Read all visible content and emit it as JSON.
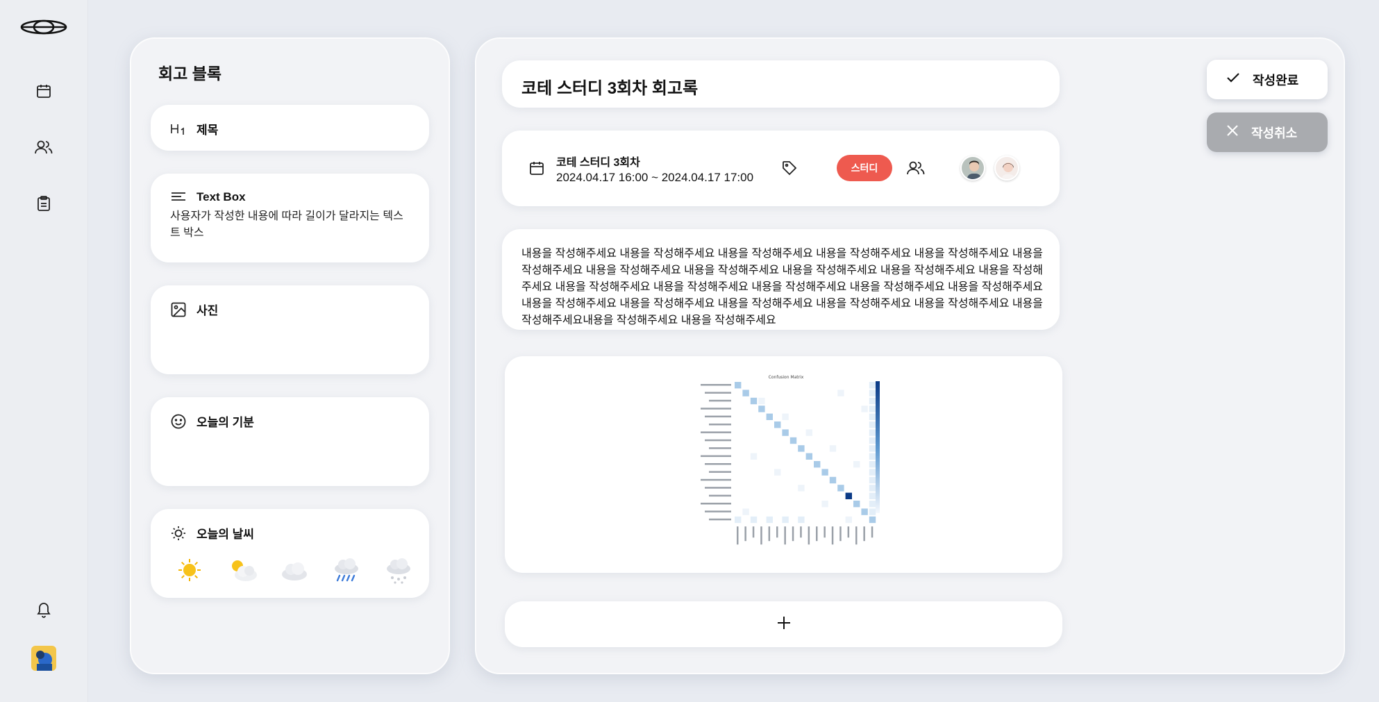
{
  "sidebar": {
    "logo_icon": "eye-logo-icon",
    "items": [
      {
        "name": "calendar",
        "icon": "calendar-icon"
      },
      {
        "name": "team",
        "icon": "users-icon"
      },
      {
        "name": "retrospective",
        "icon": "clipboard-icon"
      }
    ],
    "bottom": [
      {
        "name": "notifications",
        "icon": "bell-icon"
      },
      {
        "name": "profile",
        "icon": "avatar"
      }
    ]
  },
  "blocks_panel": {
    "title": "회고 블록",
    "blocks": [
      {
        "label": "제목",
        "icon": "heading-icon"
      },
      {
        "label": "Text Box",
        "icon": "text-lines-icon",
        "description": "사용자가 작성한 내용에 따라 길이가 달라지는 텍스트 박스"
      },
      {
        "label": "사진",
        "icon": "image-icon"
      },
      {
        "label": "오늘의 기분",
        "icon": "smile-icon"
      },
      {
        "label": "오늘의 날씨",
        "icon": "sun-outline-icon"
      }
    ],
    "weather_options": [
      "sunny-icon",
      "partly-cloudy-icon",
      "cloudy-icon",
      "rain-icon",
      "snow-icon"
    ]
  },
  "document": {
    "title": "코테 스터디 3회차 회고록",
    "event_name": "코테 스터디 3회차",
    "event_time": "2024.04.17 16:00 ~ 2024.04.17 17:00",
    "tag": "스터디",
    "tag_color": "#ee5a4f",
    "participants_count_shown": 2,
    "content": "내용을 작성해주세요 내용을 작성해주세요 내용을 작성해주세요 내용을 작성해주세요 내용을 작성해주세요 내용을 작성해주세요 내용을 작성해주세요 내용을 작성해주세요 내용을 작성해주세요 내용을 작성해주세요 내용을 작성해주세요 내용을 작성해주세요 내용을 작성해주세요 내용을 작성해주세요 내용을 작성해주세요 내용을 작성해주세요 내용을 작성해주세요 내용을 작성해주세요 내용을 작성해주세요 내용을 작성해주세요 내용을 작성해주세요 내용을 작성해주세요내용을 작성해주세요 내용을 작성해주세요",
    "image_caption": "Confusion Matrix",
    "add_icon": "plus-icon"
  },
  "actions": {
    "done_label": "작성완료",
    "cancel_label": "작성취소"
  },
  "colors": {
    "accent_red": "#ee5a4f",
    "matrix_dark": "#0b3a86",
    "cancel_gray": "#a9abaf"
  }
}
